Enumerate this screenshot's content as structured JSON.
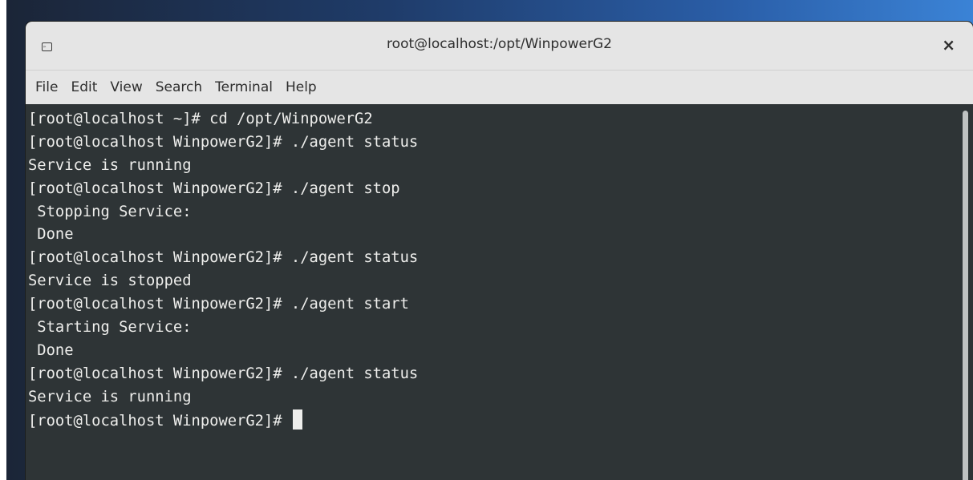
{
  "window": {
    "title": "root@localhost:/opt/WinpowerG2",
    "close_glyph": "×",
    "icon": "terminal-icon",
    "icon_glyph": "▹"
  },
  "menu": [
    {
      "label": "File"
    },
    {
      "label": "Edit"
    },
    {
      "label": "View"
    },
    {
      "label": "Search"
    },
    {
      "label": "Terminal"
    },
    {
      "label": "Help"
    }
  ],
  "terminal": {
    "lines": [
      "[root@localhost ~]# cd /opt/WinpowerG2",
      "[root@localhost WinpowerG2]# ./agent status",
      "Service is running",
      "[root@localhost WinpowerG2]# ./agent stop",
      " Stopping Service:",
      " Done",
      "[root@localhost WinpowerG2]# ./agent status",
      "Service is stopped",
      "[root@localhost WinpowerG2]# ./agent start",
      " Starting Service:",
      " Done",
      "[root@localhost WinpowerG2]# ./agent status",
      "Service is running",
      "[root@localhost WinpowerG2]# "
    ]
  },
  "colors": {
    "terminal_bg": "#2e3436",
    "terminal_fg": "#eeeeec",
    "chrome_bg": "#e5e5e5"
  }
}
